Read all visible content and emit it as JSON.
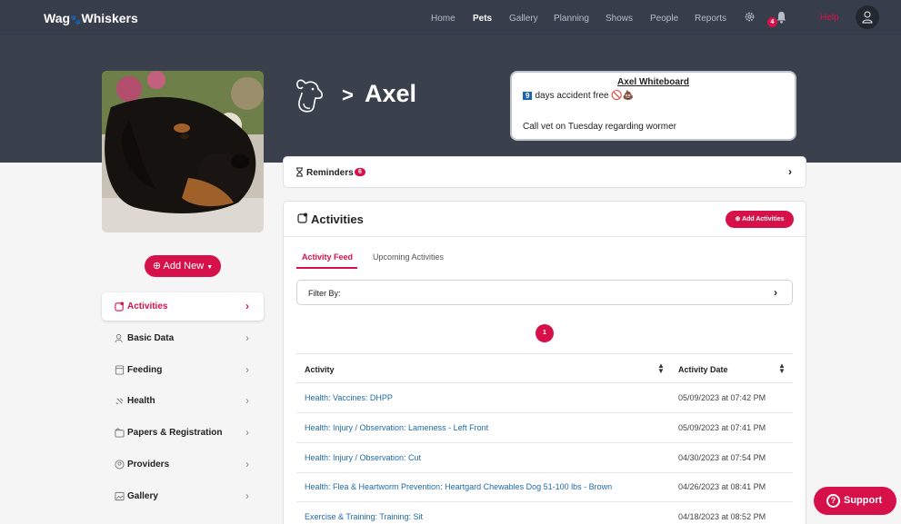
{
  "brand": {
    "part1": "Wag",
    "part2": "Whiskers"
  },
  "nav": {
    "items": [
      "Home",
      "Pets",
      "Gallery",
      "Planning",
      "Shows",
      "People",
      "Reports"
    ],
    "active": "Pets",
    "notification_count": "4",
    "help": "Help"
  },
  "pet": {
    "name": "Axel",
    "separator": ">"
  },
  "whiteboard": {
    "title": "Axel Whiteboard",
    "count": "9",
    "line1_text": "days accident free",
    "line1_emoji": "🚫💩",
    "line2": "Call vet on Tuesday regarding wormer"
  },
  "sidebar": {
    "add_new": "Add New",
    "items": [
      {
        "label": "Activities",
        "icon": "activities-icon"
      },
      {
        "label": "Basic Data",
        "icon": "basic-data-icon"
      },
      {
        "label": "Feeding",
        "icon": "feeding-icon"
      },
      {
        "label": "Health",
        "icon": "health-icon"
      },
      {
        "label": "Papers & Registration",
        "icon": "papers-icon"
      },
      {
        "label": "Providers",
        "icon": "providers-icon"
      },
      {
        "label": "Gallery",
        "icon": "gallery-icon"
      }
    ]
  },
  "reminders": {
    "label": "Reminders",
    "count": "6"
  },
  "activities": {
    "title": "Activities",
    "add_button": "Add Activities",
    "tabs": [
      "Activity Feed",
      "Upcoming Activities"
    ],
    "filter_label": "Filter By:",
    "page": "1",
    "columns": [
      "Activity",
      "Activity Date"
    ],
    "rows": [
      {
        "activity": "Health: Vaccines: DHPP",
        "date": "05/09/2023 at 07:42 PM"
      },
      {
        "activity": "Health: Injury / Observation: Lameness - Left Front",
        "date": "05/09/2023 at 07:41 PM"
      },
      {
        "activity": "Health: Injury / Observation: Cut",
        "date": "04/30/2023 at 07:54 PM"
      },
      {
        "activity": "Health: Flea & Heartworm Prevention: Heartgard Chewables Dog 51-100 lbs - Brown",
        "date": "04/26/2023 at 08:41 PM"
      },
      {
        "activity": "Exercise & Training: Training: Sit",
        "date": "04/18/2023 at 08:52 PM"
      }
    ]
  },
  "support": {
    "label": "Support",
    "icon_glyph": "?"
  },
  "colors": {
    "accent": "#d6114a",
    "topbar": "#373d4a",
    "hero": "#3a404c",
    "link": "#1f6aa9"
  }
}
